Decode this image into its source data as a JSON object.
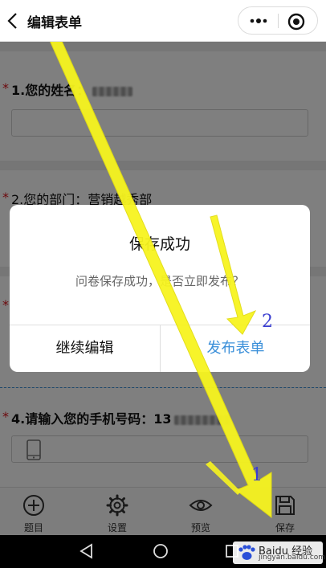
{
  "header": {
    "title": "编辑表单"
  },
  "questions": [
    {
      "required_mark": "*",
      "label": "1.您的姓名："
    },
    {
      "required_mark": "*",
      "label": "2.您的部门：营销越秀部"
    },
    {
      "required_mark": "*"
    },
    {
      "required_mark": "*",
      "label": "4.请输入您的手机号码：13"
    }
  ],
  "dialog": {
    "title": "保存成功",
    "message": "问卷保存成功，是否立即发布？",
    "cancel_label": "继续编辑",
    "confirm_label": "发布表单"
  },
  "annotations": {
    "step1": "1",
    "step2": "2"
  },
  "tabbar": [
    {
      "label": "题目",
      "icon": "plus-circle-icon"
    },
    {
      "label": "设置",
      "icon": "gear-icon"
    },
    {
      "label": "预览",
      "icon": "eye-icon"
    },
    {
      "label": "保存",
      "icon": "floppy-disk-icon"
    }
  ],
  "watermark": {
    "text": "Baidu 经验",
    "url": "jingyan.baidu.com"
  },
  "colors": {
    "accent": "#3a8fd9",
    "required": "#d8141b",
    "arrow": "#f5f31e",
    "annotation": "#3b3fd1"
  }
}
